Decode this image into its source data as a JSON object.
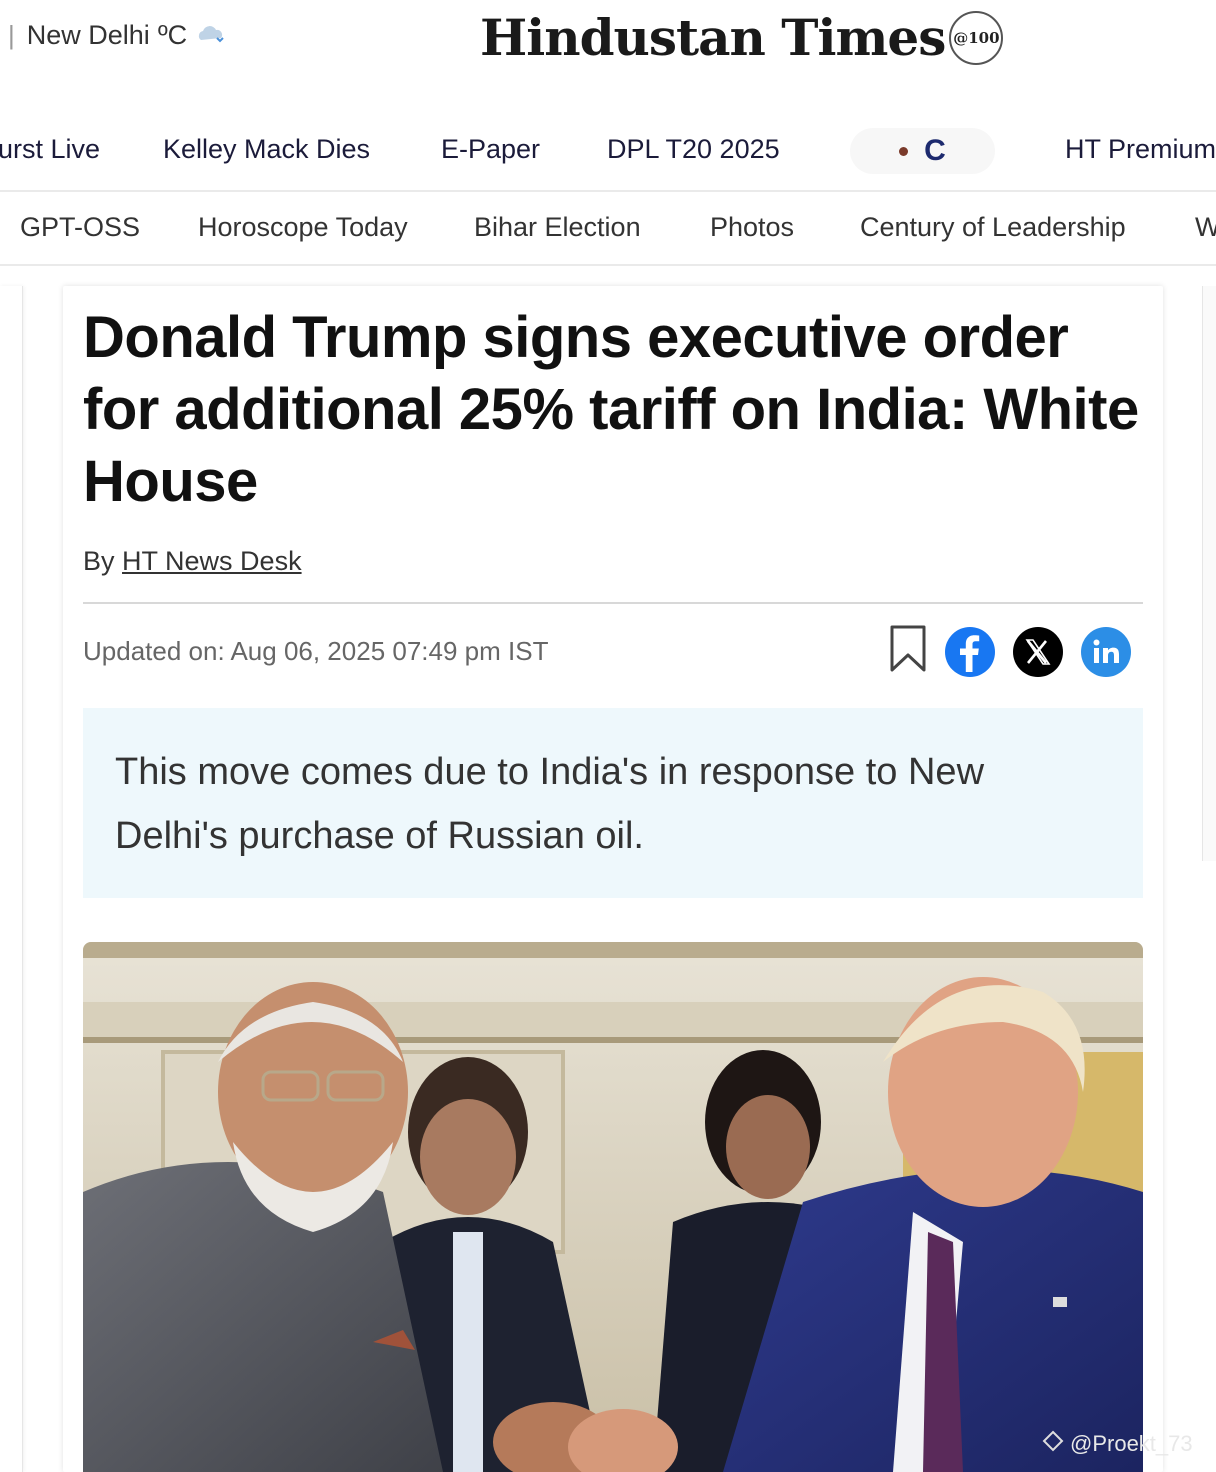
{
  "header": {
    "weather_city": "New Delhi",
    "weather_unit": "ºC",
    "logo_text": "Hindustan Times",
    "logo_badge": "@100"
  },
  "nav_primary": {
    "items": [
      "urst Live",
      "Kelley Mack Dies",
      "E-Paper",
      "DPL T20 2025",
      "HT Premium"
    ],
    "pill_text": "C"
  },
  "nav_secondary": {
    "items": [
      "GPT-OSS",
      "Horoscope Today",
      "Bihar Election",
      "Photos",
      "Century of Leadership",
      "W"
    ]
  },
  "article": {
    "headline": "Donald Trump signs executive order for additional 25% tariff on India: White House",
    "byline_prefix": "By",
    "author": "HT News Desk",
    "updated": "Updated on: Aug 06, 2025 07:49 pm IST",
    "summary": "This move comes due to India's in response to New Delhi's purchase of Russian oil."
  },
  "share_icons": [
    "bookmark-icon",
    "facebook-icon",
    "x-icon",
    "linkedin-icon"
  ],
  "watermark": "@Proekt_73",
  "colors": {
    "facebook": "#1877f2",
    "x": "#000000",
    "linkedin": "#2c8ee6",
    "summary_bg": "#eef8fc",
    "nav_text": "#1b1b3a"
  }
}
